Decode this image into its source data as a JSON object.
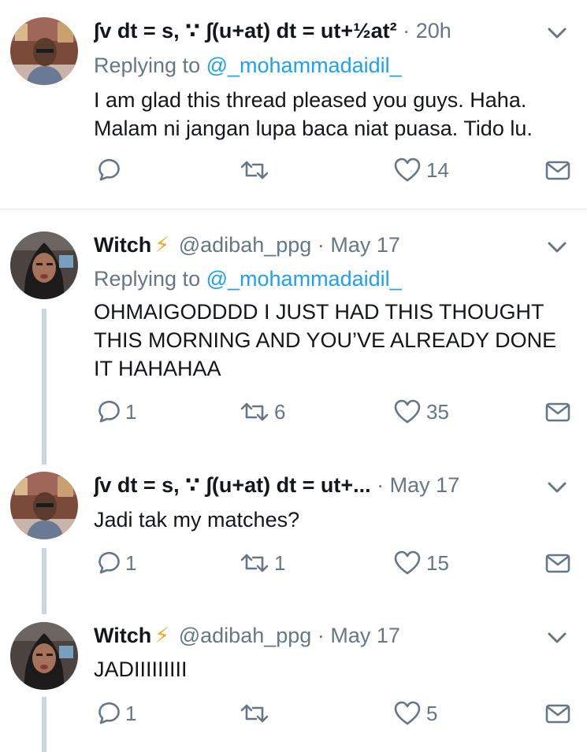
{
  "tweets": [
    {
      "author": "∫v dt = s, ∵ ∫(u+at) dt = ut+½at²",
      "bolt": "",
      "handle": "",
      "sep": "·",
      "time": "20h",
      "replying_label": "Replying to",
      "replying_handle": "@_mohammadaidil_",
      "text": [
        "I am glad this thread pleased you guys. Haha.",
        "Malam ni jangan lupa baca niat puasa. Tido lu."
      ],
      "replies": "",
      "retweets": "",
      "likes": "14"
    },
    {
      "author": "Witch",
      "bolt": "⚡",
      "handle": "@adibah_ppg",
      "sep": "·",
      "time": "May 17",
      "replying_label": "Replying to",
      "replying_handle": "@_mohammadaidil_",
      "text": [
        "OHMAIGODDDD I JUST HAD THIS THOUGHT",
        "THIS MORNING AND YOU’VE  ALREADY DONE",
        "IT HAHAHAA"
      ],
      "replies": "1",
      "retweets": "6",
      "likes": "35"
    },
    {
      "author": "∫v dt = s, ∵ ∫(u+at) dt = ut+...",
      "bolt": "",
      "handle": "",
      "sep": "·",
      "time": "May 17",
      "text": [
        "Jadi tak my matches?"
      ],
      "replies": "1",
      "retweets": "1",
      "likes": "15"
    },
    {
      "author": "Witch",
      "bolt": "⚡",
      "handle": "@adibah_ppg",
      "sep": "·",
      "time": "May 17",
      "text": [
        "JADIIIIIIIII"
      ],
      "replies": "1",
      "retweets": "",
      "likes": "5"
    }
  ],
  "icons": {
    "reply": "reply-icon",
    "retweet": "retweet-icon",
    "like": "heart-icon",
    "dm": "envelope-icon",
    "caret": "chevron-down-icon",
    "bolt": "lightning-bolt-emoji"
  },
  "colors": {
    "link": "#1da1f2",
    "muted": "#657786",
    "thread_line": "#ccd6dd",
    "bolt": "#f4a623"
  }
}
